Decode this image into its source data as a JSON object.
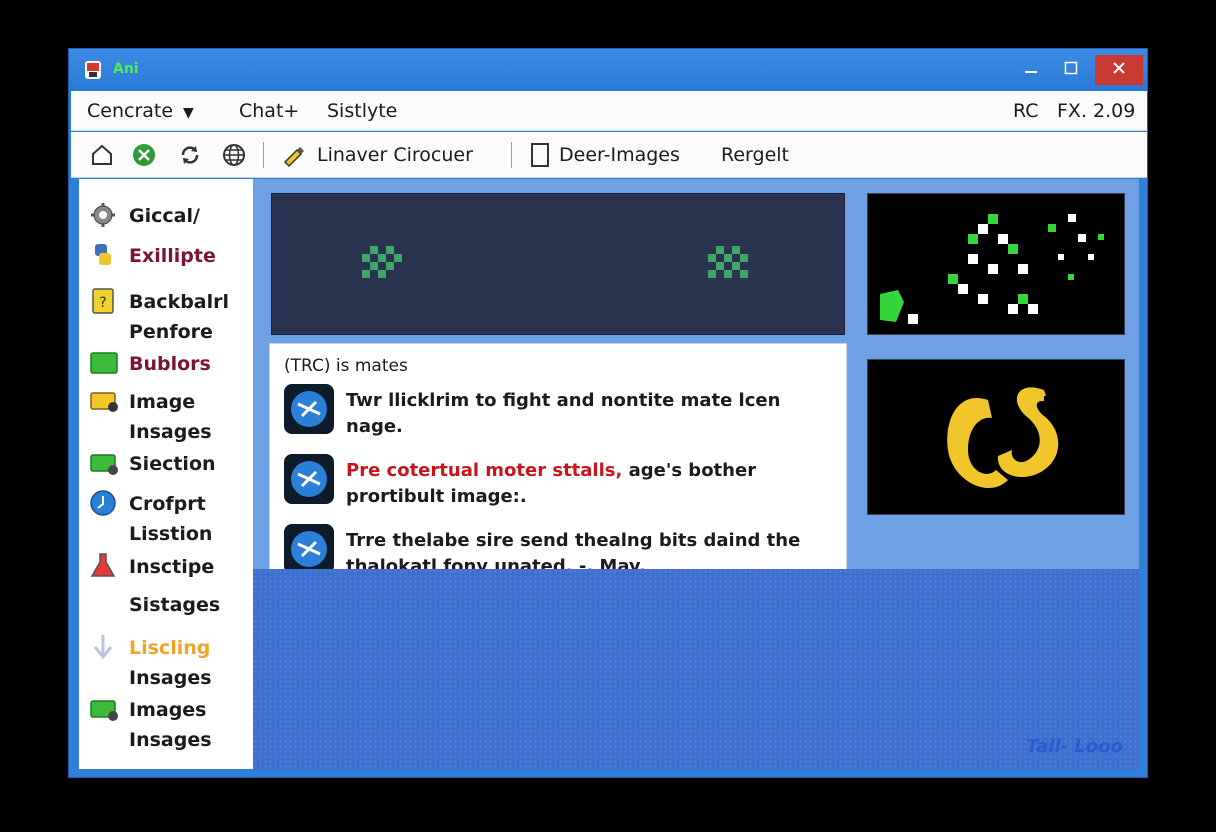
{
  "window": {
    "title": "Ani"
  },
  "menubar": {
    "items": [
      {
        "label": "Cencrate",
        "arrow": "▼"
      },
      {
        "label": "Chat+"
      },
      {
        "label": "Sistlyte"
      }
    ],
    "right": [
      "RC",
      "FX. 2.09"
    ]
  },
  "toolbar": {
    "icons": [
      "home-icon",
      "xbox-icon",
      "refresh-icon",
      "globe-icon"
    ],
    "linaver_label": "Linaver Cirocuer",
    "deer_label": "Deer-Images",
    "rergelt_label": "Rergelt"
  },
  "sidebar": {
    "items": [
      {
        "icon": "gear-icon",
        "line1": "Giccal/",
        "line2": "",
        "color": "#1b1b1b"
      },
      {
        "icon": "python-icon",
        "line1": "Exillipte",
        "line2": "",
        "color": "#7a1432"
      },
      {
        "icon": "question-folder-icon",
        "line1": "Backbalrl",
        "line2": "Penfore",
        "color": "#1b1b1b"
      },
      {
        "icon": "green-folder-icon",
        "line1": "Bublors",
        "line2": "",
        "color": "#7a1432"
      },
      {
        "icon": "image-folder-icon",
        "line1": "Image",
        "line2": "Insages",
        "color": "#1b1b1b"
      },
      {
        "icon": "green-image-icon",
        "line1": "Siection",
        "line2": "",
        "color": "#1b1b1b"
      },
      {
        "icon": "blue-circle-icon",
        "line1": "Crofprt",
        "line2": "Lisstion",
        "color": "#1b1b1b"
      },
      {
        "icon": "flask-icon",
        "line1": "Insctipe",
        "line2": "Sistages",
        "color": "#1b1b1b"
      },
      {
        "icon": "down-arrow-icon",
        "line1": "Liscling",
        "line2": "Insages",
        "color": "#f0a52a"
      },
      {
        "icon": "green-image-icon",
        "line1": "Images",
        "line2": "Insages",
        "color": "#1b1b1b"
      }
    ]
  },
  "messages": {
    "header": "(TRC) is mates",
    "items": [
      {
        "prefix": "",
        "text": "Twr llicklrim to fight and nontite mate lcen nage."
      },
      {
        "prefix": "Pre cotertual moter sttalls,",
        "text": " age's bother prortibult image:."
      },
      {
        "prefix": "",
        "text": "Trre thelabe sire send thealng bits daind the thalokatl fony unated. -.   May."
      }
    ]
  },
  "desktop": {
    "watermark": "Tall- Looo"
  },
  "colors": {
    "accent": "#2f7fd8",
    "highlight": "#c6161b",
    "banner": "#2a3350"
  }
}
